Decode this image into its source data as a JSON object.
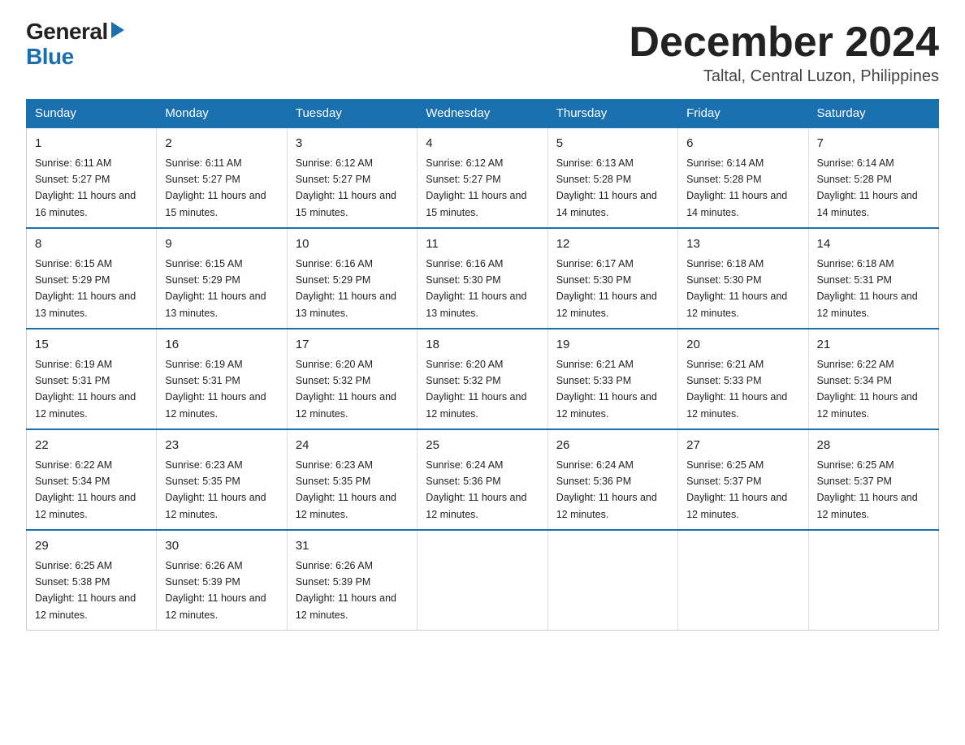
{
  "logo": {
    "general": "General",
    "blue": "Blue"
  },
  "title": {
    "month": "December 2024",
    "location": "Taltal, Central Luzon, Philippines"
  },
  "days_of_week": [
    "Sunday",
    "Monday",
    "Tuesday",
    "Wednesday",
    "Thursday",
    "Friday",
    "Saturday"
  ],
  "weeks": [
    [
      {
        "day": "1",
        "sunrise": "6:11 AM",
        "sunset": "5:27 PM",
        "daylight": "11 hours and 16 minutes."
      },
      {
        "day": "2",
        "sunrise": "6:11 AM",
        "sunset": "5:27 PM",
        "daylight": "11 hours and 15 minutes."
      },
      {
        "day": "3",
        "sunrise": "6:12 AM",
        "sunset": "5:27 PM",
        "daylight": "11 hours and 15 minutes."
      },
      {
        "day": "4",
        "sunrise": "6:12 AM",
        "sunset": "5:27 PM",
        "daylight": "11 hours and 15 minutes."
      },
      {
        "day": "5",
        "sunrise": "6:13 AM",
        "sunset": "5:28 PM",
        "daylight": "11 hours and 14 minutes."
      },
      {
        "day": "6",
        "sunrise": "6:14 AM",
        "sunset": "5:28 PM",
        "daylight": "11 hours and 14 minutes."
      },
      {
        "day": "7",
        "sunrise": "6:14 AM",
        "sunset": "5:28 PM",
        "daylight": "11 hours and 14 minutes."
      }
    ],
    [
      {
        "day": "8",
        "sunrise": "6:15 AM",
        "sunset": "5:29 PM",
        "daylight": "11 hours and 13 minutes."
      },
      {
        "day": "9",
        "sunrise": "6:15 AM",
        "sunset": "5:29 PM",
        "daylight": "11 hours and 13 minutes."
      },
      {
        "day": "10",
        "sunrise": "6:16 AM",
        "sunset": "5:29 PM",
        "daylight": "11 hours and 13 minutes."
      },
      {
        "day": "11",
        "sunrise": "6:16 AM",
        "sunset": "5:30 PM",
        "daylight": "11 hours and 13 minutes."
      },
      {
        "day": "12",
        "sunrise": "6:17 AM",
        "sunset": "5:30 PM",
        "daylight": "11 hours and 12 minutes."
      },
      {
        "day": "13",
        "sunrise": "6:18 AM",
        "sunset": "5:30 PM",
        "daylight": "11 hours and 12 minutes."
      },
      {
        "day": "14",
        "sunrise": "6:18 AM",
        "sunset": "5:31 PM",
        "daylight": "11 hours and 12 minutes."
      }
    ],
    [
      {
        "day": "15",
        "sunrise": "6:19 AM",
        "sunset": "5:31 PM",
        "daylight": "11 hours and 12 minutes."
      },
      {
        "day": "16",
        "sunrise": "6:19 AM",
        "sunset": "5:31 PM",
        "daylight": "11 hours and 12 minutes."
      },
      {
        "day": "17",
        "sunrise": "6:20 AM",
        "sunset": "5:32 PM",
        "daylight": "11 hours and 12 minutes."
      },
      {
        "day": "18",
        "sunrise": "6:20 AM",
        "sunset": "5:32 PM",
        "daylight": "11 hours and 12 minutes."
      },
      {
        "day": "19",
        "sunrise": "6:21 AM",
        "sunset": "5:33 PM",
        "daylight": "11 hours and 12 minutes."
      },
      {
        "day": "20",
        "sunrise": "6:21 AM",
        "sunset": "5:33 PM",
        "daylight": "11 hours and 12 minutes."
      },
      {
        "day": "21",
        "sunrise": "6:22 AM",
        "sunset": "5:34 PM",
        "daylight": "11 hours and 12 minutes."
      }
    ],
    [
      {
        "day": "22",
        "sunrise": "6:22 AM",
        "sunset": "5:34 PM",
        "daylight": "11 hours and 12 minutes."
      },
      {
        "day": "23",
        "sunrise": "6:23 AM",
        "sunset": "5:35 PM",
        "daylight": "11 hours and 12 minutes."
      },
      {
        "day": "24",
        "sunrise": "6:23 AM",
        "sunset": "5:35 PM",
        "daylight": "11 hours and 12 minutes."
      },
      {
        "day": "25",
        "sunrise": "6:24 AM",
        "sunset": "5:36 PM",
        "daylight": "11 hours and 12 minutes."
      },
      {
        "day": "26",
        "sunrise": "6:24 AM",
        "sunset": "5:36 PM",
        "daylight": "11 hours and 12 minutes."
      },
      {
        "day": "27",
        "sunrise": "6:25 AM",
        "sunset": "5:37 PM",
        "daylight": "11 hours and 12 minutes."
      },
      {
        "day": "28",
        "sunrise": "6:25 AM",
        "sunset": "5:37 PM",
        "daylight": "11 hours and 12 minutes."
      }
    ],
    [
      {
        "day": "29",
        "sunrise": "6:25 AM",
        "sunset": "5:38 PM",
        "daylight": "11 hours and 12 minutes."
      },
      {
        "day": "30",
        "sunrise": "6:26 AM",
        "sunset": "5:39 PM",
        "daylight": "11 hours and 12 minutes."
      },
      {
        "day": "31",
        "sunrise": "6:26 AM",
        "sunset": "5:39 PM",
        "daylight": "11 hours and 12 minutes."
      },
      null,
      null,
      null,
      null
    ]
  ],
  "labels": {
    "sunrise": "Sunrise:",
    "sunset": "Sunset:",
    "daylight": "Daylight:"
  }
}
